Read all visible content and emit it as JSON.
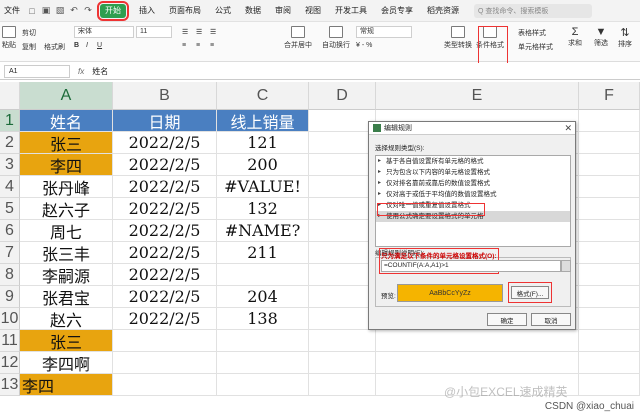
{
  "menubar": {
    "file": "文件",
    "active_tab": "开始",
    "tabs": [
      "插入",
      "页面布局",
      "公式",
      "数据",
      "审阅",
      "视图",
      "开发工具",
      "会员专享",
      "稻壳资源"
    ],
    "search_placeholder": "Q 查找命令、搜索模板"
  },
  "ribbon": {
    "paste": "粘贴",
    "cut": "剪切",
    "copy": "复制",
    "format_painter": "格式刷",
    "font_name": "宋体",
    "font_size": "11",
    "merge_center": "合并居中",
    "auto_wrap": "自动换行",
    "number_format": "常规",
    "type_convert": "类型转换",
    "conditional_format": "条件格式",
    "table_style": "表格样式",
    "cell_style": "单元格样式",
    "sum": "求和",
    "filter": "筛选",
    "sort": "排序"
  },
  "formula_bar": {
    "name_box": "A1",
    "fx": "fx",
    "value": "姓名"
  },
  "columns": [
    "A",
    "B",
    "C",
    "D",
    "E",
    "F"
  ],
  "rows": [
    "1",
    "2",
    "3",
    "4",
    "5",
    "6",
    "7",
    "8",
    "9",
    "10",
    "11",
    "12",
    "13"
  ],
  "table": {
    "headers": [
      "姓名",
      "日期",
      "线上销量"
    ],
    "rows": [
      [
        "张三",
        "2022/2/5",
        "121"
      ],
      [
        "李四",
        "2022/2/5",
        "200"
      ],
      [
        "张丹峰",
        "2022/2/5",
        "#VALUE!"
      ],
      [
        "赵六子",
        "2022/2/5",
        "132"
      ],
      [
        "周七",
        "2022/2/5",
        "#NAME?"
      ],
      [
        "张三丰",
        "2022/2/5",
        "211"
      ],
      [
        "李嗣源",
        "2022/2/5",
        ""
      ],
      [
        "张君宝",
        "2022/2/5",
        "204"
      ],
      [
        "赵六",
        "2022/2/5",
        "138"
      ],
      [
        "张三",
        "",
        ""
      ],
      [
        "李四啊",
        "",
        ""
      ],
      [
        "李四",
        "",
        ""
      ]
    ],
    "highlight_color": "#e8a40f",
    "header_color": "#4a7fc1"
  },
  "dialog": {
    "title": "编辑规则",
    "rule_type_label": "选择规则类型(S):",
    "rule_types": [
      "基于各自值设置所有单元格的格式",
      "只为包含以下内容的单元格设置格式",
      "仅对排名靠前或靠后的数值设置格式",
      "仅对高于或低于平均值的数值设置格式",
      "仅对唯一值或重复值设置格式",
      "使用公式确定要设置格式的单元格"
    ],
    "desc_label": "编辑规则说明(E):",
    "formula_label": "只为满足以下条件的单元格设置格式(O):",
    "formula": "=COUNTIF(A:A,A1)>1",
    "preview_label": "预览:",
    "preview_text": "AaBbCcYyZz",
    "format_button": "格式(F)...",
    "ok": "确定",
    "cancel": "取消"
  },
  "watermark": "@小包EXCEL速成精英",
  "csdn": "CSDN @xiao_chuai"
}
